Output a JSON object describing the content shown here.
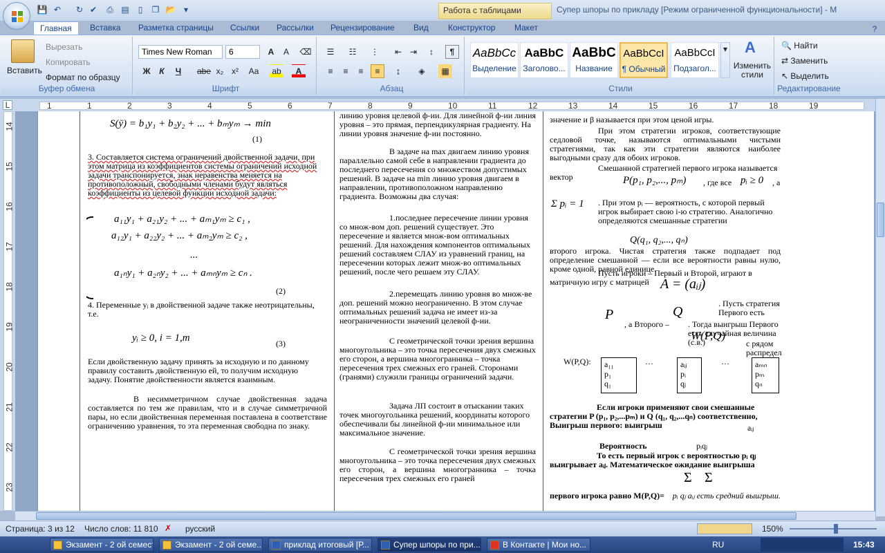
{
  "window": {
    "title": "Супер шпоры по прикладу [Режим ограниченной функциональности] - M",
    "context_tab": "Работа с таблицами"
  },
  "tabs": [
    "Главная",
    "Вставка",
    "Разметка страницы",
    "Ссылки",
    "Рассылки",
    "Рецензирование",
    "Вид",
    "Конструктор",
    "Макет"
  ],
  "clipboard": {
    "paste": "Вставить",
    "cut": "Вырезать",
    "copy": "Копировать",
    "format_painter": "Формат по образцу",
    "label": "Буфер обмена"
  },
  "font": {
    "name": "Times New Roman",
    "size": "6",
    "label": "Шрифт",
    "bold": "Ж",
    "italic": "К",
    "underline": "Ч",
    "strike": "abe",
    "sub": "x₂",
    "sup": "x²",
    "case": "Aa"
  },
  "paragraph": {
    "label": "Абзац"
  },
  "styles": {
    "label": "Стили",
    "items": [
      {
        "sample": "AaBbCc",
        "name": "Выделение"
      },
      {
        "sample": "AaBbC",
        "name": "Заголово..."
      },
      {
        "sample": "AaBbC",
        "name": "Название"
      },
      {
        "sample": "AaBbCcI",
        "name": "¶ Обычный"
      },
      {
        "sample": "AaBbCcI",
        "name": "Подзагол..."
      }
    ],
    "change": "Изменить стили"
  },
  "editing": {
    "label": "Редактирование",
    "find": "Найти",
    "replace": "Заменить",
    "select": "Выделить"
  },
  "ruler": {
    "marks": [
      "1",
      "1",
      "2",
      "3",
      "4",
      "5",
      "6",
      "7",
      "8",
      "9",
      "10",
      "11",
      "12",
      "13",
      "14",
      "15",
      "16",
      "17",
      "18",
      "19"
    ],
    "vmarks": [
      "14",
      "15",
      "16",
      "17",
      "18",
      "19",
      "20",
      "21",
      "22",
      "23"
    ]
  },
  "doc": {
    "col1": {
      "formula_top": "S(ȳ) = b₁y₁ + b₂y₂ + ... + bₘyₘ → min",
      "eq1": "(1)",
      "p3": "3.   Составляется система ограничений двойственной задачи, при этом матрица из коэффициентов системы ограничений исходной задачи транспонируется,  знак неравенства меняется на противоположный, свободными членами будут являться коэффициенты из целевой функции исходной задачи:",
      "sys1": "a₁₁y₁ + a₂₁y₂ + ... + aₘ₁yₘ  ≥ c₁ ,",
      "sys2": "a₁₂y₁ + a₂₂y₂ + ... + aₘ₂yₘ  ≥ c₂ ,",
      "sys3": "...",
      "sys4": "a₁ₙy₁ + a₂ₙy₂ + ... + aₘₙyₘ  ≥ cₙ .",
      "eq2": "(2)",
      "p4": "4.   Переменные yᵢ в двойственной задаче также неотрицательны, т.е.",
      "cond": "yᵢ ≥ 0,        i = 1,m",
      "eq3": "(3)",
      "p5": "Если двойственную задачу принять за исходную и по данному правилу составить двойственную ей, то получим исходную задачу. Понятие двойственности  является взаимным.",
      "p6": "В несимметричном случае двойственная задача составляется по тем же правилам, что и в случае симметричной пары, но если двойственная переменная поставлена в соответствие ограничению уравнения, то эта переменная свободна по знаку."
    },
    "col2": {
      "p1": "линию уровня целевой ф-ии. Для линейной ф-ии линия уровня – это прямая, перпендикулярная градиенту. На линии уровня значение ф-ии постоянно.",
      "p2": "В задаче на max двигаем линию уровня параллельно самой себе в направлении градиента  до последнего пересечения  со множеством допустимых решений. В задаче на min линию уровня двигаем в направлении, противоположном направлению градиента. Возможны два случая:",
      "p3": "1.последнее пересечение  линии уровня со множ-вом доп. решений  существует. Это пересечение  и является множ-вом оптимальных решений. Для нахождения компонентов оптимальных решений составляем СЛАУ из уравнений границ, на пересечении которых лежит  множ-во оптимальных решений, после чего решаем эту СЛАУ.",
      "p4": "2.перемещать линию уровня во множ-ве доп. решений можно неограниченно.  В этом случае оптимальных решений  задача не имеет из-за неограниченности  значений целевой ф-ии.",
      "p5": "С геометрической точки зрения вершина многоугольника – это точка пересечения  двух смежных его сторон, а вершина многогранника – точка пересечения  трех смежных его граней. Сторонами (гранями) служили границы ограничений задачи.",
      "p6": "Задача ЛП состоит в отыскании таких точек многоугольника решений, координаты которого обеспечивали бы линейной ф-ии минимальное или максимальное значение.",
      "p7": "С  геометрической точки зрения вершина многоугольника  –  это  точка  пересечения  двух  смежных его сторон, а вершина многогранника – точка пересечения  трех смежных его граней"
    },
    "col3": {
      "p1": "значение и β называется при этом ценой игры.",
      "p2": "При этом стратегии игроков, соответствующие седловой точке, называются оптимальными чистыми стратегиями, так как эти стратегии являются наиболее выгодными сразу для обоих игроков.",
      "p3a": "Смешанной стратегией первого игрока называется вектор",
      "p3m": "P(p₁, p₂,..., pₘ)",
      "p3b": ", где все",
      "p3c": "pᵢ ≥ 0",
      "p3d": ", а",
      "sum1": "Σ pᵢ = 1",
      "p4": ". При этом  pᵢ — вероятность, с которой первый игрок выбирает свою i-ю стратегию. Аналогично определяются смешанные стратегии",
      "q": "Q(q₁, q₂,..., qₙ)",
      "p4b": "второго игрока. Чистая стратегия также подпадает под определение смешанной — если все вероятности равны нулю, кроме одной, равной единице.",
      "p5": "Пусть игроки – Первый и Второй, играют в матричную игру с матрицей",
      "A": "A = (aᵢⱼ)",
      "p5b": ". Пусть стратегия Первого есть",
      "P": "P",
      "p5c": ", а Второго –",
      "Q": "Q",
      "p5d": ". Тогда выигрыш Первого есть случайная величина (с.в.)",
      "W": "W(P,Q)",
      "p5e": "с рядом распределения:",
      "wlabel": "W(P,Q):",
      "table": {
        "a": "a₁₁",
        "p1": "p₁",
        "q1": "q₁",
        "ai": "aᵢⱼ",
        "pi": "pᵢ",
        "qj": "qⱼ",
        "am": "aₘₙ",
        "pm": "pₘ",
        "qn": "qₙ",
        "dots": "…"
      },
      "p6": "Если игроки применяют свои смешанные стратегии P (p₁, p₂,...pₘ) и Q (q₁, q₂,...qₙ) соответственно, Выигрыш первого: выигрыш",
      "aij": "aᵢⱼ",
      "p7a": "Вероятность",
      "p7b": "pᵢqⱼ",
      "p8": "То есть первый игрок с вероятностью pᵢ qⱼ выигрывает aᵢⱼ.  Математическое ожидание выигрыша",
      "p9": "первого игрока равно  M(P,Q)=",
      "p9b": "pᵢ qⱼ aᵢⱼ есть средний выигрыш."
    }
  },
  "status": {
    "page": "Страница: 3 из 12",
    "words": "Число слов: 11 810",
    "lang": "русский",
    "zoom": "150%"
  },
  "taskbar": {
    "items": [
      "Экзамент - 2 ой семест...",
      "Экзамент - 2 ой семе...",
      "приклад итоговый [Р...",
      "Супер шпоры по при...",
      "В Контакте | Мои но..."
    ],
    "lang": "RU",
    "clock": "15:43"
  }
}
